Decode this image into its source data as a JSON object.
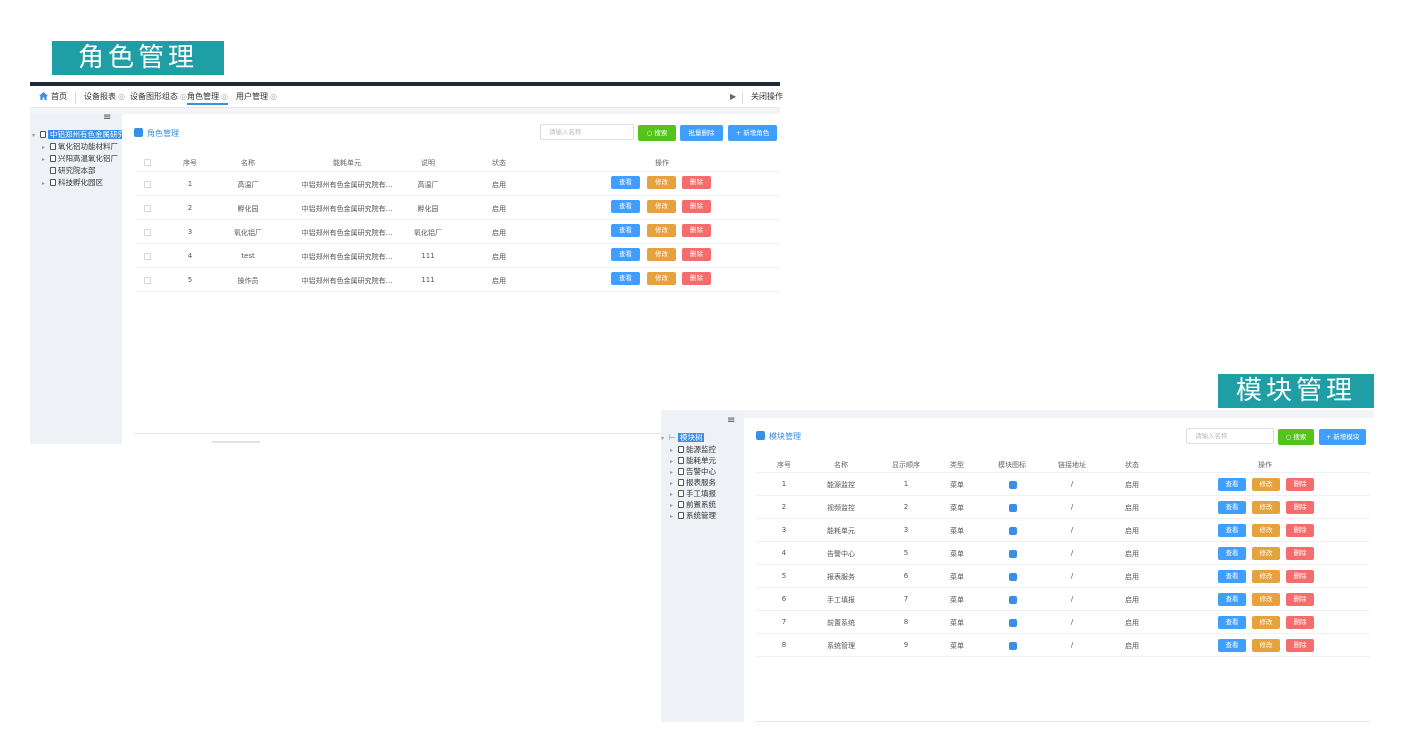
{
  "titles": {
    "role": "角色管理",
    "module": "模块管理"
  },
  "panel1": {
    "tabs": [
      {
        "label": "首页"
      },
      {
        "label": "设备报表"
      },
      {
        "label": "设备图形组态"
      },
      {
        "label": "角色管理"
      },
      {
        "label": "用户管理"
      }
    ],
    "tab_close_symbol": "◎",
    "close_ops": "关闭操作",
    "tree": {
      "root": "中铝郑州有色金属研究",
      "children": [
        "氧化铝功能材料厂",
        "兴阳高温氧化铝厂",
        "研究院本部",
        "科技孵化园区"
      ]
    },
    "title": "角色管理",
    "search_placeholder": "请输入名称",
    "buttons": {
      "search": "搜索",
      "batch_delete": "批量删除",
      "add": "+ 新增角色"
    },
    "columns": [
      "序号",
      "名称",
      "能耗单元",
      "说明",
      "状态",
      "操作"
    ],
    "rows": [
      {
        "no": "1",
        "name": "高温厂",
        "unit": "中铝郑州有色金属研究院有...",
        "desc": "高温厂",
        "status": "启用"
      },
      {
        "no": "2",
        "name": "孵化园",
        "unit": "中铝郑州有色金属研究院有...",
        "desc": "孵化园",
        "status": "启用"
      },
      {
        "no": "3",
        "name": "氧化铝厂",
        "unit": "中铝郑州有色金属研究院有...",
        "desc": "氧化铝厂",
        "status": "启用"
      },
      {
        "no": "4",
        "name": "test",
        "unit": "中铝郑州有色金属研究院有...",
        "desc": "111",
        "status": "启用"
      },
      {
        "no": "5",
        "name": "操作员",
        "unit": "中铝郑州有色金属研究院有...",
        "desc": "111",
        "status": "启用"
      }
    ],
    "row_actions": {
      "view": "查看",
      "edit": "修改",
      "delete": "删除"
    }
  },
  "panel2": {
    "tree": {
      "root": "模块树",
      "children": [
        "能源监控",
        "能耗单元",
        "告警中心",
        "报表服务",
        "手工填报",
        "前置系统",
        "系统管理"
      ]
    },
    "title": "模块管理",
    "search_placeholder": "请输入名称",
    "buttons": {
      "search": "搜索",
      "add": "+ 新增模块"
    },
    "columns": [
      "序号",
      "名称",
      "显示顺序",
      "类型",
      "模块图标",
      "链接地址",
      "状态",
      "操作"
    ],
    "rows": [
      {
        "no": "1",
        "name": "能源监控",
        "order": "1",
        "type": "菜单",
        "icon": "grid-icon",
        "link": "/",
        "status": "启用"
      },
      {
        "no": "2",
        "name": "视频监控",
        "order": "2",
        "type": "菜单",
        "icon": "monitor-icon",
        "link": "/",
        "status": "启用"
      },
      {
        "no": "3",
        "name": "能耗单元",
        "order": "3",
        "type": "菜单",
        "icon": "shield-icon",
        "link": "/",
        "status": "启用"
      },
      {
        "no": "4",
        "name": "告警中心",
        "order": "5",
        "type": "菜单",
        "icon": "bell-icon",
        "link": "/",
        "status": "启用"
      },
      {
        "no": "5",
        "name": "报表服务",
        "order": "6",
        "type": "菜单",
        "icon": "report-icon",
        "link": "/",
        "status": "启用"
      },
      {
        "no": "6",
        "name": "手工填报",
        "order": "7",
        "type": "菜单",
        "icon": "cube-icon",
        "link": "/",
        "status": "启用"
      },
      {
        "no": "7",
        "name": "前置系统",
        "order": "8",
        "type": "菜单",
        "icon": "tag-icon",
        "link": "/",
        "status": "启用"
      },
      {
        "no": "8",
        "name": "系统管理",
        "order": "9",
        "type": "菜单",
        "icon": "home-icon",
        "link": "/",
        "status": "启用"
      }
    ],
    "row_actions": {
      "view": "查看",
      "edit": "修改",
      "delete": "删除"
    }
  },
  "colors": {
    "title_bg": "#1f9ea6",
    "primary": "#409eff",
    "success": "#52c41a",
    "warning": "#e6a23c",
    "danger": "#f56c6c"
  }
}
